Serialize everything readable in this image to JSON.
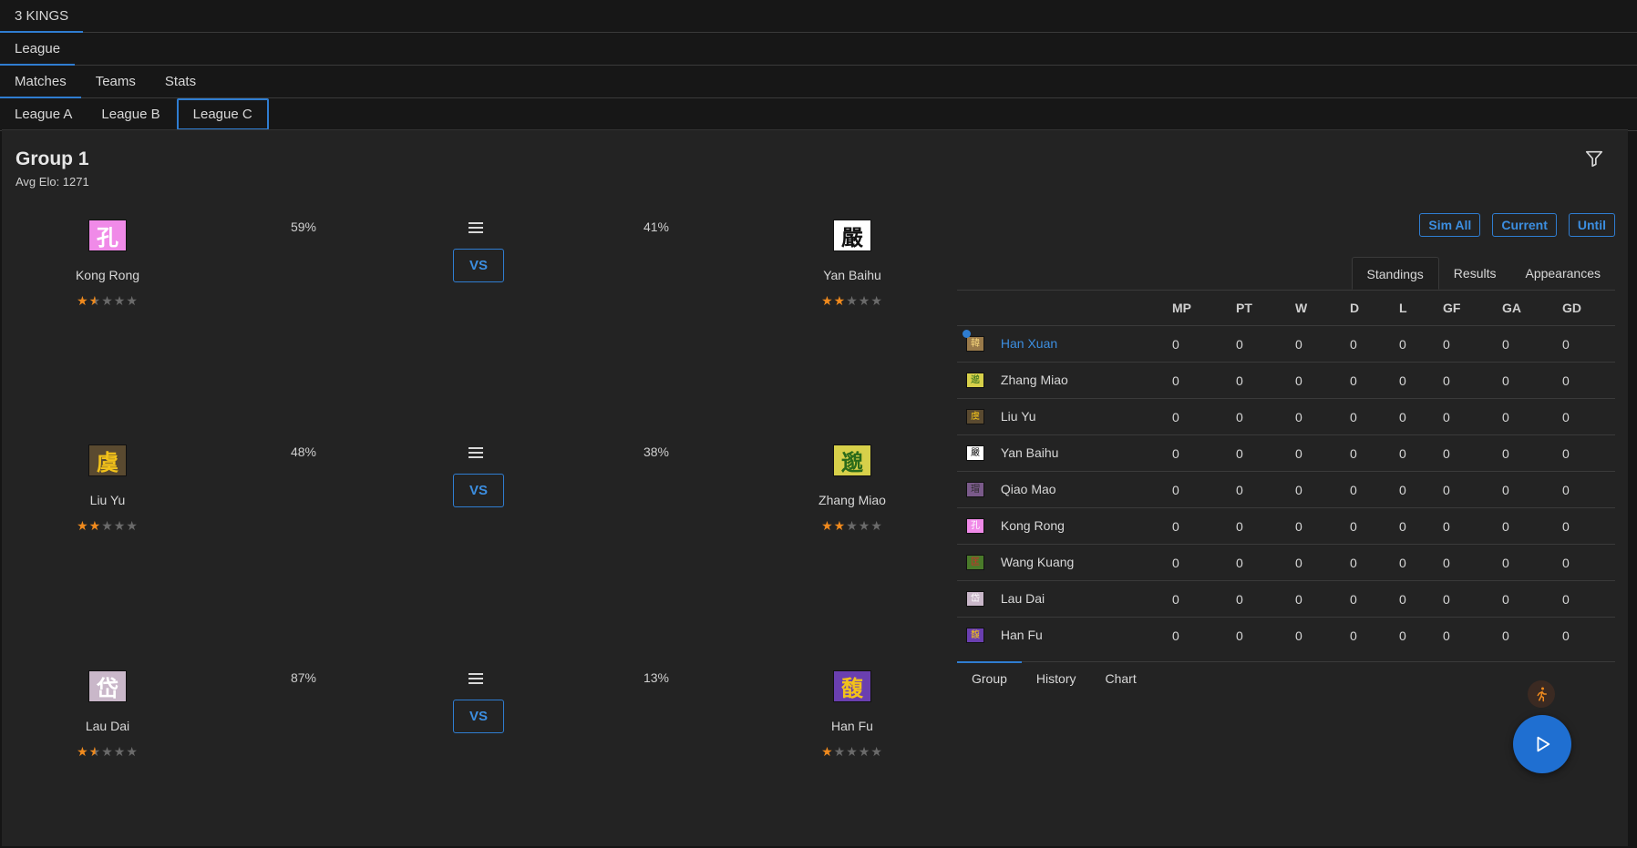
{
  "app": {
    "title": "3 KINGS"
  },
  "nav": {
    "level1": [
      "League"
    ],
    "level2": [
      "Matches",
      "Teams",
      "Stats"
    ],
    "level3": [
      "League A",
      "League B",
      "League C"
    ]
  },
  "group": {
    "title": "Group 1",
    "avg_elo": "Avg Elo: 1271"
  },
  "buttons": {
    "sim_all": "Sim All",
    "current": "Current",
    "until": "Until",
    "vs": "VS"
  },
  "matches": [
    {
      "home": {
        "name": "Kong Rong",
        "glyph": "孔",
        "bg": "#f08ae8",
        "fg": "#ffffff",
        "stars": 1.5
      },
      "home_pct": "59%",
      "away_pct": "41%",
      "away": {
        "name": "Yan Baihu",
        "glyph": "嚴",
        "bg": "#ffffff",
        "fg": "#111111",
        "stars": 2
      }
    },
    {
      "home": {
        "name": "Liu Yu",
        "glyph": "虞",
        "bg": "#5a4a30",
        "fg": "#f2c21a",
        "stars": 2
      },
      "home_pct": "48%",
      "away_pct": "38%",
      "away": {
        "name": "Zhang Miao",
        "glyph": "邈",
        "bg": "#d7d04a",
        "fg": "#2a6a1a",
        "stars": 2
      }
    },
    {
      "home": {
        "name": "Lau Dai",
        "glyph": "岱",
        "bg": "#c9b7c9",
        "fg": "#ffffff",
        "stars": 1.5
      },
      "home_pct": "87%",
      "away_pct": "13%",
      "away": {
        "name": "Han Fu",
        "glyph": "馥",
        "bg": "#6a3fb0",
        "fg": "#f2c21a",
        "stars": 1
      }
    }
  ],
  "standings": {
    "tabs": [
      "Standings",
      "Results",
      "Appearances"
    ],
    "columns": [
      "MP",
      "PT",
      "W",
      "D",
      "L",
      "GF",
      "GA",
      "GD"
    ],
    "rows": [
      {
        "name": "Han Xuan",
        "glyph": "韓",
        "bg": "#9a7a4a",
        "fg": "#f2d27a",
        "highlight": true,
        "stats": [
          "0",
          "0",
          "0",
          "0",
          "0",
          "0",
          "0",
          "0"
        ]
      },
      {
        "name": "Zhang Miao",
        "glyph": "邈",
        "bg": "#d7d04a",
        "fg": "#2a6a1a",
        "highlight": false,
        "stats": [
          "0",
          "0",
          "0",
          "0",
          "0",
          "0",
          "0",
          "0"
        ]
      },
      {
        "name": "Liu Yu",
        "glyph": "虞",
        "bg": "#5a4a30",
        "fg": "#f2c21a",
        "highlight": false,
        "stats": [
          "0",
          "0",
          "0",
          "0",
          "0",
          "0",
          "0",
          "0"
        ]
      },
      {
        "name": "Yan Baihu",
        "glyph": "嚴",
        "bg": "#ffffff",
        "fg": "#111111",
        "highlight": false,
        "stats": [
          "0",
          "0",
          "0",
          "0",
          "0",
          "0",
          "0",
          "0"
        ]
      },
      {
        "name": "Qiao Mao",
        "glyph": "瑁",
        "bg": "#7a5a8a",
        "fg": "#2a2a2a",
        "highlight": false,
        "stats": [
          "0",
          "0",
          "0",
          "0",
          "0",
          "0",
          "0",
          "0"
        ]
      },
      {
        "name": "Kong Rong",
        "glyph": "孔",
        "bg": "#f08ae8",
        "fg": "#ffffff",
        "highlight": false,
        "stats": [
          "0",
          "0",
          "0",
          "0",
          "0",
          "0",
          "0",
          "0"
        ]
      },
      {
        "name": "Wang Kuang",
        "glyph": "匡",
        "bg": "#4a7a2a",
        "fg": "#d22a2a",
        "highlight": false,
        "stats": [
          "0",
          "0",
          "0",
          "0",
          "0",
          "0",
          "0",
          "0"
        ]
      },
      {
        "name": "Lau Dai",
        "glyph": "岱",
        "bg": "#c9b7c9",
        "fg": "#ffffff",
        "highlight": false,
        "stats": [
          "0",
          "0",
          "0",
          "0",
          "0",
          "0",
          "0",
          "0"
        ]
      },
      {
        "name": "Han Fu",
        "glyph": "馥",
        "bg": "#6a3fb0",
        "fg": "#f2c21a",
        "highlight": false,
        "stats": [
          "0",
          "0",
          "0",
          "0",
          "0",
          "0",
          "0",
          "0"
        ]
      }
    ]
  },
  "bottom_tabs": [
    "Group",
    "History",
    "Chart"
  ],
  "colors": {
    "accent": "#2f7dd1",
    "star": "#f08a1d",
    "fab": "#1f6fd1",
    "link": "#3c8ee0"
  },
  "icons": {
    "filter": "filter-icon",
    "menu": "menu-icon",
    "runner": "runner-icon",
    "play": "play-icon"
  }
}
